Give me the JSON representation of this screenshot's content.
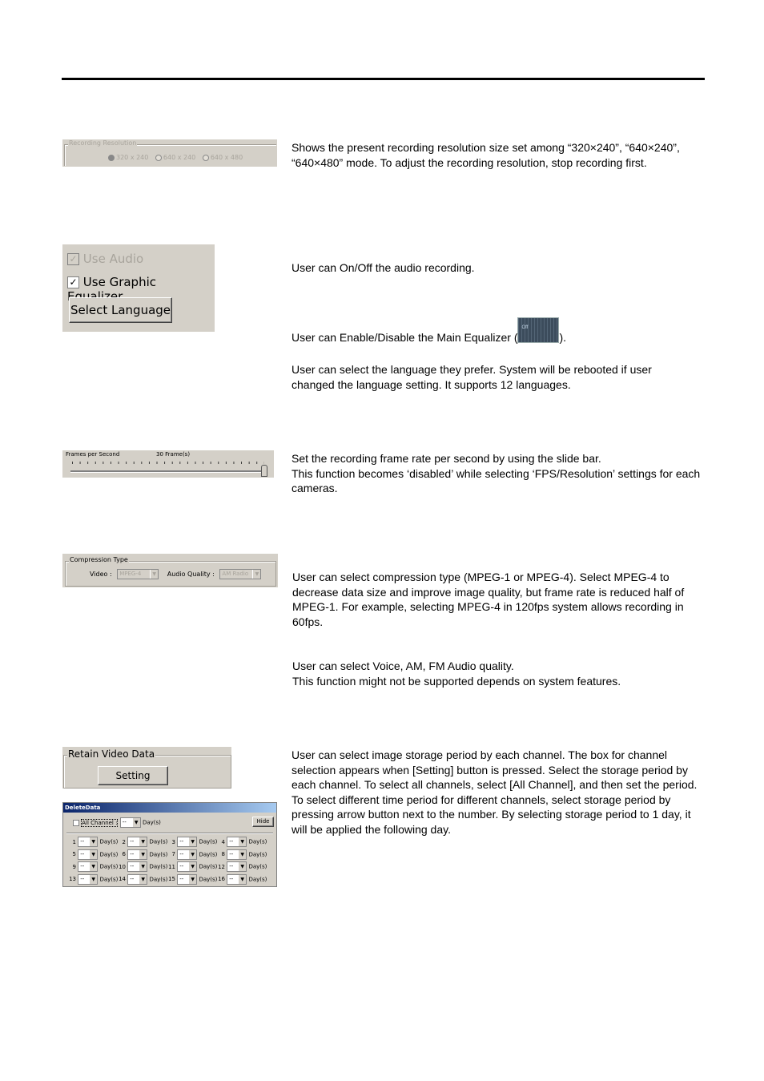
{
  "recording_resolution": {
    "title": "Recording Resolution",
    "options": [
      "320 x 240",
      "640 x 240",
      "640 x 480"
    ],
    "selected": 0,
    "description": "Shows the present recording resolution size set among “320×240”, “640×240”, “640×480” mode. To adjust the recording resolution, stop recording first."
  },
  "audio_panel": {
    "use_audio": "Use Audio",
    "use_audio_checked": true,
    "use_audio_disabled": true,
    "use_eq": "Use Graphic Equalizer",
    "use_eq_checked": true,
    "select_language": "Select Language"
  },
  "audio_desc": "User can On/Off the audio recording.",
  "eq_desc_before": "User can Enable/Disable the Main Equalizer (",
  "eq_desc_after": ").",
  "eq_icon_label": "Off",
  "language_desc": "User can select the language they prefer. System will be rebooted if user changed the language setting. It supports 12 languages.",
  "fps": {
    "label": "Frames per Second",
    "value_text": "30 Frame(s)",
    "level": 1.0,
    "desc1": "Set the recording frame rate per second by using the slide bar.",
    "desc2": "This function becomes ‘disabled’ while selecting ‘FPS/Resolution’ settings for each cameras."
  },
  "compression": {
    "title": "Compression Type",
    "video_label": "Video :",
    "video_value": "MPEG-4",
    "audio_label": "Audio Quality :",
    "audio_value": "AM Radio",
    "desc": "User can select compression type (MPEG-1 or MPEG-4). Select MPEG-4 to decrease data size and improve image quality, but frame rate is reduced half of MPEG-1. For example, selecting MPEG-4 in 120fps system allows recording in 60fps.",
    "audio_desc1": "User can select Voice, AM, FM Audio quality.",
    "audio_desc2": "This function might not be supported depends on system features."
  },
  "retain": {
    "title": "Retain Video Data",
    "setting": "Setting",
    "desc": "User can select image storage period by each channel. The box for channel selection appears when [Setting] button is pressed. Select the storage period by each channel. To select all channels, select [All Channel], and then set the period. To select different time period for different channels, select storage period by pressing arrow button next to the number. By selecting storage period to 1 day, it will be applied the following day."
  },
  "delete_data": {
    "title": "DeleteData",
    "all_channel": "All Channel :",
    "value": "--",
    "days": "Day(s)",
    "hide": "Hide",
    "channels": [
      "1",
      "2",
      "3",
      "4",
      "5",
      "6",
      "7",
      "8",
      "9",
      "10",
      "11",
      "12",
      "13",
      "14",
      "15",
      "16"
    ]
  },
  "colors": {
    "panel": "#d4d0c8",
    "titlebar_start": "#0a246a",
    "titlebar_end": "#a6caf0"
  }
}
